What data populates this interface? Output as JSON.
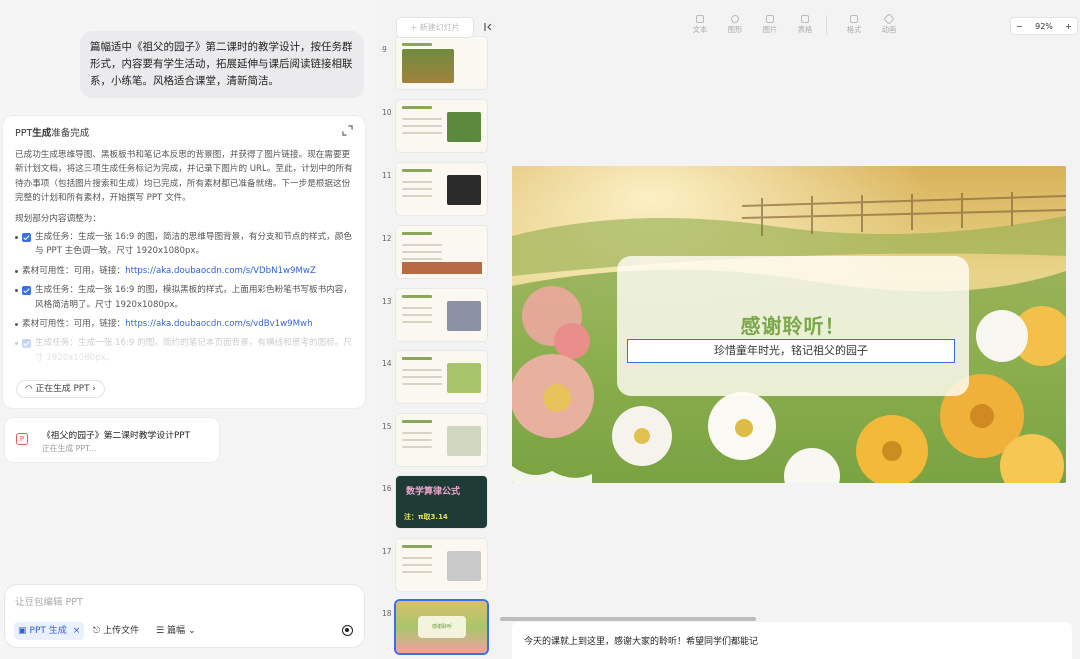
{
  "chat": {
    "user_message": "篇幅适中《祖父的园子》第二课时的教学设计，按任务群形式，内容要有学生活动，拓展延伸与课后阅读链接相联系，小练笔。风格适合课堂，清新简洁。",
    "card_title_prefix": "PPT",
    "card_title_bold": "生成",
    "card_title_suffix": "准备完成",
    "card_paragraph": "已成功生成思维导图、黑板板书和笔记本反思的背景图，并获得了图片链接。现在需要更新计划文档，将这三项生成任务标记为完成，并记录下图片的 URL。至此，计划中的所有待办事项（包括图片搜索和生成）均已完成，所有素材都已准备就绪。下一步是根据这份完整的计划和所有素材，开始撰写 PPT 文件。",
    "plan_intro": "规划部分内容调整为：",
    "plan_items": [
      {
        "type": "check",
        "text": "生成任务：生成一张 16:9 的图，简洁的思维导图背景，有分支和节点的样式，颜色与 PPT 主色调一致。尺寸 1920x1080px。",
        "link": ""
      },
      {
        "type": "dot",
        "text": "素材可用性：可用，链接：",
        "link": "https://aka.doubaocdn.com/s/VDbN1w9MwZ"
      },
      {
        "type": "check",
        "text": "生成任务：生成一张 16:9 的图，模拟黑板的样式，上面用彩色粉笔书写板书内容，风格简洁明了。尺寸 1920x1080px。",
        "link": ""
      },
      {
        "type": "dot",
        "text": "素材可用性：可用，链接：",
        "link": "https://aka.doubaocdn.com/s/vdBv1w9Mwh"
      },
      {
        "type": "check",
        "text": "生成任务：生成一张 16:9 的图，简约的笔记本页面背景，有横线和思考的图标。尺寸 1920x1080px。",
        "link": ""
      }
    ],
    "generating_pill": "正在生成 PPT",
    "file_title": "《祖父的园子》第二课时教学设计PPT",
    "file_subtitle": "正在生成 PPT...",
    "file_icon_letter": "P",
    "composer_placeholder": "让豆包编辑 PPT",
    "composer_ppt_chip": "PPT 生成",
    "composer_upload": "上传文件",
    "composer_length": "篇幅"
  },
  "thumbnails": {
    "new_slide_label": "+ 新建幻灯片",
    "items": [
      {
        "num": "9"
      },
      {
        "num": "10"
      },
      {
        "num": "11"
      },
      {
        "num": "12"
      },
      {
        "num": "13"
      },
      {
        "num": "14"
      },
      {
        "num": "15"
      },
      {
        "num": "16",
        "dark_text": "数学算律公式",
        "dark_note": "注：π取3.14"
      },
      {
        "num": "17"
      },
      {
        "num": "18",
        "label": "感谢聆听"
      }
    ]
  },
  "toolbar": {
    "text": "文本",
    "shape": "图形",
    "image": "图片",
    "table": "表格",
    "style": "格式",
    "animation": "动画",
    "zoom_minus": "−",
    "zoom_value": "92%",
    "zoom_plus": "+"
  },
  "slide": {
    "title": "感谢聆听！",
    "subtitle": "珍惜童年时光，铭记祖父的园子"
  },
  "notes": "今天的课就上到这里，感谢大家的聆听！希望同学们都能记"
}
